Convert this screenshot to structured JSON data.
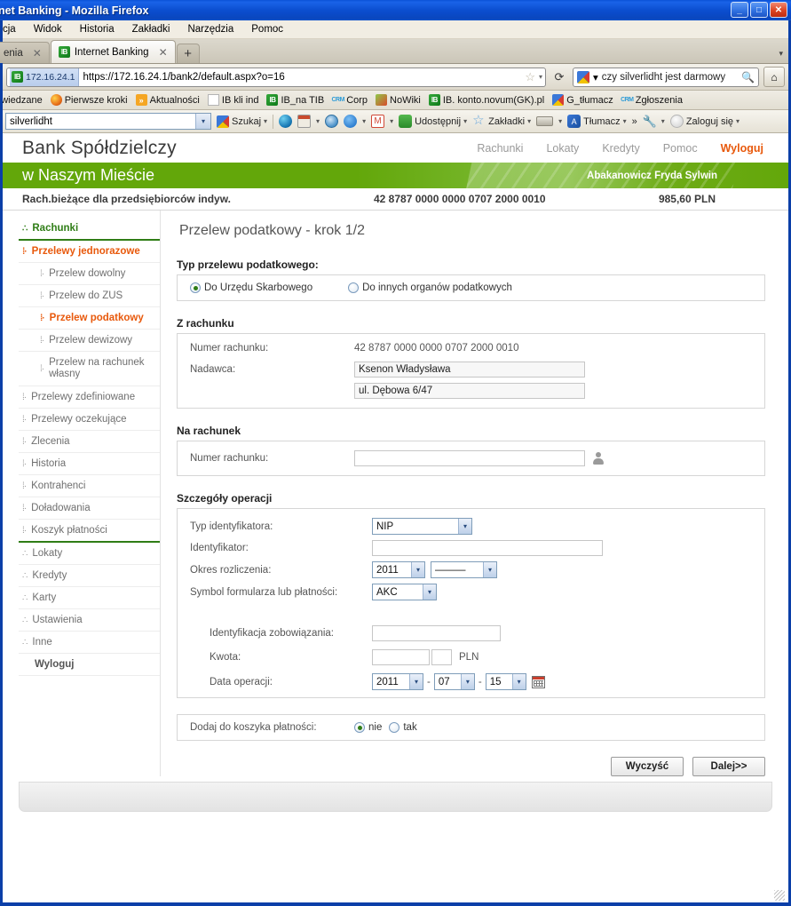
{
  "window": {
    "title": "net Banking - Mozilla Firefox",
    "minimize": "_",
    "maximize": "□",
    "close": "✕"
  },
  "menubar": {
    "items": [
      "cja",
      "Widok",
      "Historia",
      "Zakładki",
      "Narzędzia",
      "Pomoc"
    ]
  },
  "tabs": [
    {
      "label": "enia",
      "icon": "",
      "active": false
    },
    {
      "label": "Internet Banking",
      "icon": "IB",
      "active": true
    }
  ],
  "tab_new_label": "+",
  "tab_list_arrow": "▾",
  "navbar": {
    "identity_badge": "172.16.24.1",
    "identity_icon": "IB",
    "url": "https://172.16.24.1/bank2/default.aspx?o=16",
    "star_icon": "☆",
    "dropdown_caret": "▾",
    "reload_icon": "⟳",
    "search_query": "czy silverlidht jest darmowy",
    "search_icon": "magnifier-icon",
    "home_icon": "⌂"
  },
  "bookmarks": [
    {
      "label": "odwiedzane",
      "icon": "none"
    },
    {
      "label": "Pierwsze kroki",
      "icon": "firefox"
    },
    {
      "label": "Aktualności",
      "icon": "rss"
    },
    {
      "label": "IB kli ind",
      "icon": "doc"
    },
    {
      "label": "IB_na TIB",
      "icon": "ib"
    },
    {
      "label": "Corp",
      "icon": "crm"
    },
    {
      "label": "NoWiki",
      "icon": "nowiki"
    },
    {
      "label": "IB. konto.novum(GK).pl",
      "icon": "ib"
    },
    {
      "label": "G_tłumacz",
      "icon": "google"
    },
    {
      "label": "Zgłoszenia",
      "icon": "crm"
    }
  ],
  "gtoolbar": {
    "search_value": "silverlidht",
    "search_button": "Szukaj",
    "items": [
      {
        "label": "Udostępnij",
        "icon": "share-icon"
      },
      {
        "label": "Zakładki",
        "icon": "star-icon"
      },
      {
        "label": "",
        "icon": "highlight-icon"
      },
      {
        "label": "Tłumacz",
        "icon": "translate-icon"
      },
      {
        "label": "»",
        "icon": "overflow-icon"
      },
      {
        "label": "",
        "icon": "wrench-icon"
      },
      {
        "label": "Zaloguj się",
        "icon": "account-icon"
      }
    ]
  },
  "bank": {
    "name_line1": "Bank Spółdzielczy",
    "name_line2": "w Naszym Mieście",
    "topnav": [
      "Rachunki",
      "Lokaty",
      "Kredyty",
      "Pomoc"
    ],
    "logout": "Wyloguj",
    "user": "Abakanowicz Fryda Sylwin",
    "account_type": "Rach.bieżące dla przedsiębiorców indyw.",
    "account_number": "42 8787 0000 0000 0707 2000 0010",
    "balance": "985,60 PLN"
  },
  "sidebar": {
    "items": [
      {
        "label": "Rachunki",
        "style": "green",
        "dots": "∴"
      },
      {
        "label": "Przelewy jednorazowe",
        "style": "orange",
        "dots": "⁞·"
      },
      {
        "label": "Przelew dowolny",
        "style": "sub",
        "dots": "⁞·"
      },
      {
        "label": "Przelew do ZUS",
        "style": "sub",
        "dots": "⁞·"
      },
      {
        "label": "Przelew podatkowy",
        "style": "sub active",
        "dots": "⁞·"
      },
      {
        "label": "Przelew dewizowy",
        "style": "sub",
        "dots": "⁞·"
      },
      {
        "label": "Przelew na rachunek własny",
        "style": "sub",
        "dots": "⁞·"
      },
      {
        "label": "Przelewy zdefiniowane",
        "style": "lvl0",
        "dots": "⁞·"
      },
      {
        "label": "Przelewy oczekujące",
        "style": "lvl0",
        "dots": "⁞·"
      },
      {
        "label": "Zlecenia",
        "style": "lvl0",
        "dots": "⁞·"
      },
      {
        "label": "Historia",
        "style": "lvl0",
        "dots": "⁞·"
      },
      {
        "label": "Kontrahenci",
        "style": "lvl0",
        "dots": "⁞·"
      },
      {
        "label": "Doładowania",
        "style": "lvl0",
        "dots": "⁞·"
      },
      {
        "label": "Koszyk płatności",
        "style": "lvl0 sep",
        "dots": "⁞·"
      },
      {
        "label": "Lokaty",
        "style": "lvl0",
        "dots": "∴"
      },
      {
        "label": "Kredyty",
        "style": "lvl0",
        "dots": "∴"
      },
      {
        "label": "Karty",
        "style": "lvl0",
        "dots": "∴"
      },
      {
        "label": "Ustawienia",
        "style": "lvl0",
        "dots": "∴"
      },
      {
        "label": "Inne",
        "style": "lvl0",
        "dots": "∴"
      },
      {
        "label": "Wyloguj",
        "style": "plain",
        "dots": ""
      }
    ]
  },
  "form": {
    "title": "Przelew podatkowy - krok 1/2",
    "transfer_type_heading": "Typ przelewu podatkowego:",
    "transfer_type_options": [
      {
        "label": "Do Urzędu Skarbowego",
        "selected": true
      },
      {
        "label": "Do innych organów podatkowych",
        "selected": false
      }
    ],
    "from_account": {
      "heading": "Z rachunku",
      "account_label": "Numer rachunku:",
      "account_value": "42 8787 0000 0000 0707 2000 0010",
      "sender_label": "Nadawca:",
      "sender_name": "Ksenon Władysława",
      "sender_address": "ul. Dębowa 6/47"
    },
    "to_account": {
      "heading": "Na rachunek",
      "account_label": "Numer rachunku:",
      "account_value": "",
      "contacts_icon": "person-icon"
    },
    "details": {
      "heading": "Szczegóły operacji",
      "id_type_label": "Typ identyfikatora:",
      "id_type_value": "NIP",
      "identifier_label": "Identyfikator:",
      "identifier_value": "",
      "period_label": "Okres rozliczenia:",
      "period_year": "2011",
      "period_type": "———",
      "form_symbol_label": "Symbol formularza lub płatności:",
      "form_symbol_value": "AKC",
      "obligation_label": "Identyfikacja zobowiązania:",
      "obligation_value": "",
      "amount_label": "Kwota:",
      "amount_int": "",
      "amount_dec": "",
      "currency": "PLN",
      "date_label": "Data operacji:",
      "date_year": "2011",
      "date_month": "07",
      "date_day": "15",
      "date_sep": "-",
      "calendar_icon": "calendar-icon"
    },
    "basket": {
      "label": "Dodaj do koszyka płatności:",
      "options": [
        {
          "label": "nie",
          "selected": true
        },
        {
          "label": "tak",
          "selected": false
        }
      ]
    },
    "buttons": {
      "clear": "Wyczyść",
      "next": "Dalej>>"
    }
  },
  "colors": {
    "brand_green": "#63a70a",
    "accent_orange": "#e8590c",
    "nav_green": "#2f7d16",
    "titlebar_blue": "#0b4ed0"
  }
}
